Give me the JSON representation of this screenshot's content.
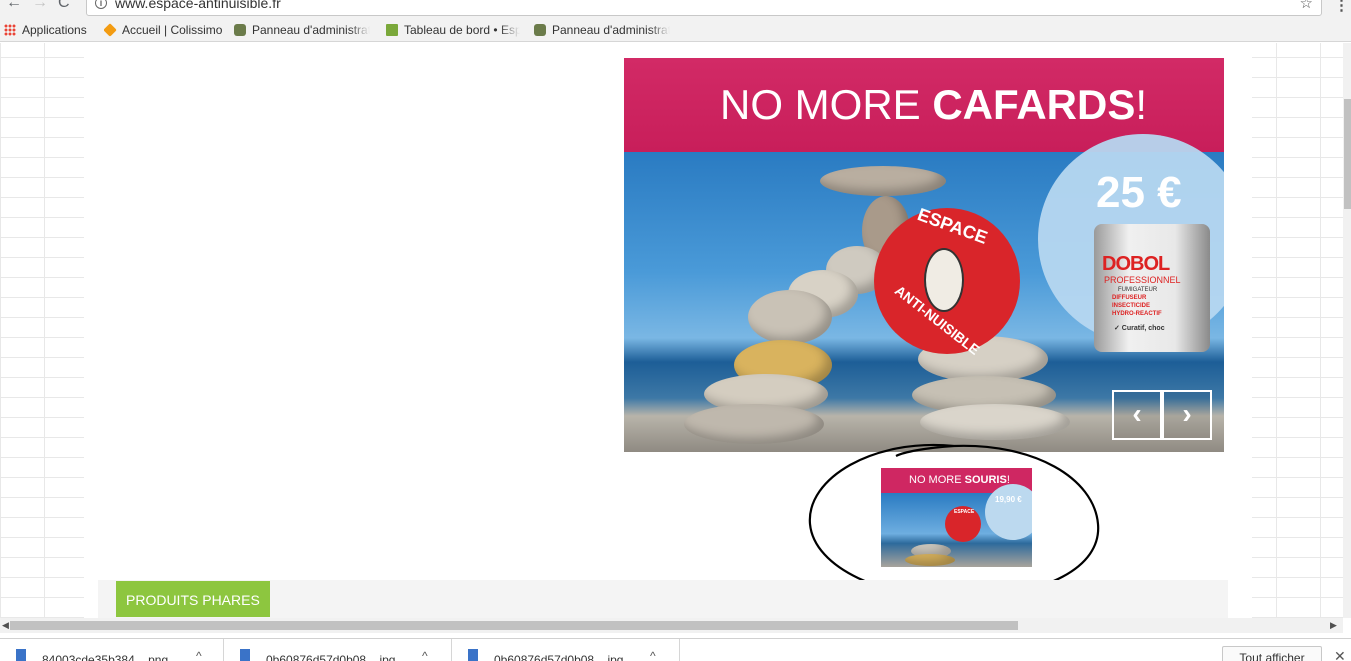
{
  "browser": {
    "url": "www.espace-antinuisible.fr",
    "back_glyph": "←",
    "forward_glyph": "→",
    "reload_glyph": "C",
    "info_glyph": "i",
    "star_glyph": "☆",
    "menu_glyph": "⋮",
    "bookmarks": [
      {
        "label": "Applications",
        "icon": "apps-grid-icon"
      },
      {
        "label": "Accueil | Colissimo",
        "icon": "box-icon"
      },
      {
        "label": "Panneau d'administrat",
        "icon": "camera-icon"
      },
      {
        "label": "Tableau de bord • Esp",
        "icon": "document-icon"
      },
      {
        "label": "Panneau d'administrat",
        "icon": "camera-icon"
      }
    ]
  },
  "slider": {
    "headline_light": "NO MORE ",
    "headline_bold": "CAFARDS",
    "headline_end": "!",
    "price": "25 €",
    "product_brand": "DOBOL",
    "product_sub": "PROFESSIONNEL",
    "product_type": "FUMIGATEUR",
    "product_line1": "DIFFUSEUR",
    "product_line2": "INSECTICIDE",
    "product_line3": "HYDRO-REACTIF",
    "product_line4": "✓ Curatif, choc",
    "logo_top": "ESPACE",
    "logo_bottom": "ANTI-NUISIBLE",
    "prev_glyph": "‹",
    "next_glyph": "›"
  },
  "thumbnail": {
    "title_light": "NO MORE ",
    "title_bold": "SOURIS",
    "title_end": "!",
    "price": "19,90 €",
    "logo_text": "ESPACE"
  },
  "products": {
    "button_label": "PRODUITS PHARES"
  },
  "scrollbar": {
    "left_glyph": "◀",
    "right_glyph": "▶"
  },
  "downloads": {
    "items": [
      {
        "name": "84003cde35b384....png",
        "chevron": "^"
      },
      {
        "name": "0b60876d57d0b08....jpg",
        "chevron": "^"
      },
      {
        "name": "0b60876d57d0b08....jpg",
        "chevron": "^"
      }
    ],
    "show_all": "Tout afficher",
    "close_glyph": "✕"
  },
  "colors": {
    "brand_pink": "#c81e5a",
    "button_green": "#8dc63f",
    "logo_red": "#d9252a"
  }
}
